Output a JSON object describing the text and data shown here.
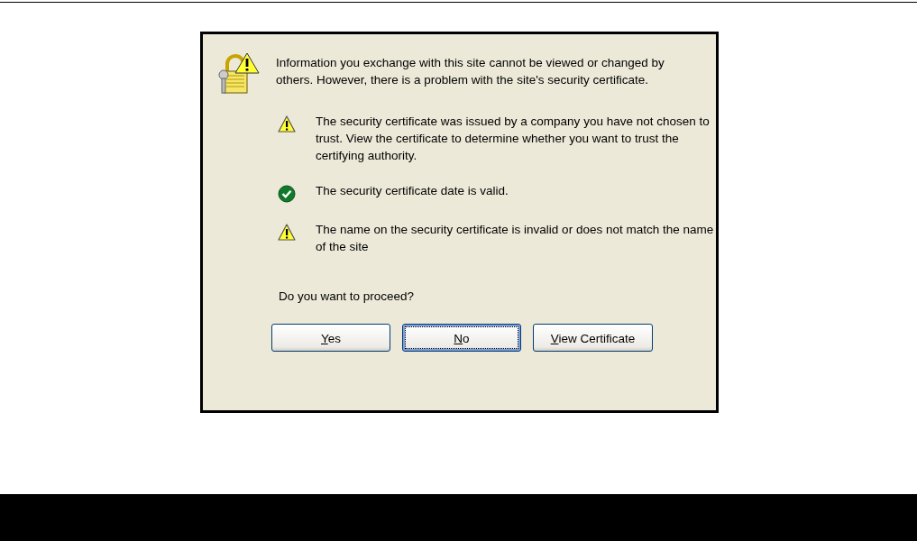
{
  "dialog": {
    "message": "Information you exchange with this site cannot be viewed or changed by others. However, there is a problem with the site's security certificate.",
    "items": [
      {
        "kind": "warning",
        "text": "The security certificate was issued by a company you have not chosen to trust. View the certificate to determine whether you want to trust the certifying authority."
      },
      {
        "kind": "ok",
        "text": "The security certificate date is valid."
      },
      {
        "kind": "warning",
        "text": "The name on the security certificate is invalid or does not match the name of the site"
      }
    ],
    "question": "Do you want to proceed?",
    "buttons": [
      {
        "accel": "Y",
        "rest": "es",
        "focused": false
      },
      {
        "accel": "N",
        "rest": "o",
        "focused": true
      },
      {
        "accel": "V",
        "rest": "iew Certificate",
        "focused": false
      }
    ]
  }
}
